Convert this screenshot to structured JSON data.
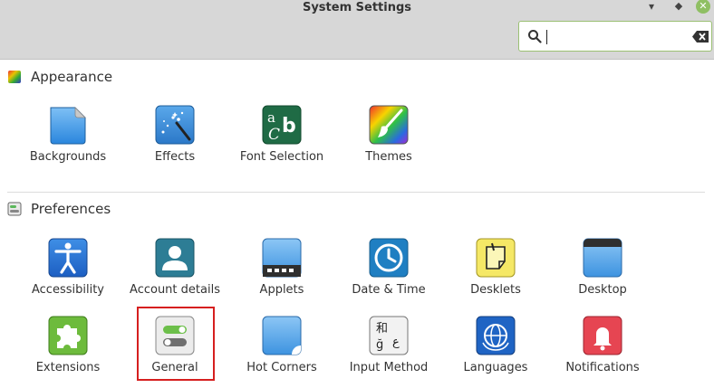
{
  "window": {
    "title": "System Settings"
  },
  "search": {
    "value": "",
    "placeholder": ""
  },
  "sections": {
    "appearance": {
      "title": "Appearance",
      "items": [
        {
          "label": "Backgrounds"
        },
        {
          "label": "Effects"
        },
        {
          "label": "Font Selection"
        },
        {
          "label": "Themes"
        }
      ]
    },
    "preferences": {
      "title": "Preferences",
      "items": [
        {
          "label": "Accessibility"
        },
        {
          "label": "Account details"
        },
        {
          "label": "Applets"
        },
        {
          "label": "Date & Time"
        },
        {
          "label": "Desklets"
        },
        {
          "label": "Desktop"
        },
        {
          "label": "Extensions"
        },
        {
          "label": "General"
        },
        {
          "label": "Hot Corners"
        },
        {
          "label": "Input Method"
        },
        {
          "label": "Languages"
        },
        {
          "label": "Notifications"
        }
      ]
    }
  },
  "font_icon": {
    "a": "a",
    "c": "C",
    "b": "b"
  },
  "input_method_icon": {
    "top": "和",
    "left": "ğ",
    "right": "ع"
  },
  "colors": {
    "accent": "#8fbf63",
    "highlight_border": "#d61f1f",
    "titlebar": "#d7d7d7"
  }
}
